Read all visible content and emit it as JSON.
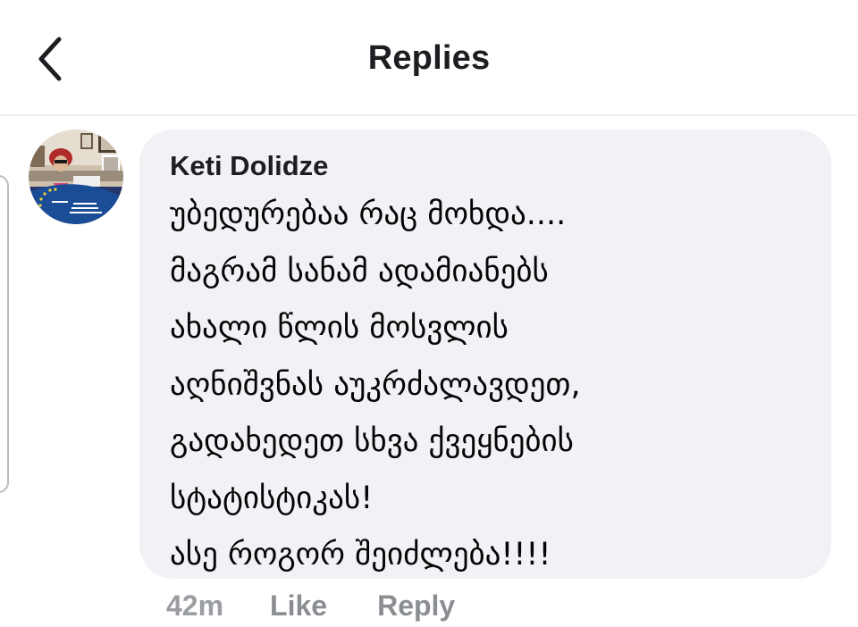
{
  "header": {
    "title": "Replies",
    "back_icon": "chevron-left-icon"
  },
  "comment": {
    "author": "Keti Dolidze",
    "lines": [
      "უბედურებაა რაც მოხდა....",
      "მაგრამ სანამ ადამიანებს",
      "ახალი წლის მოსვლის",
      "აღნიშვნას აუკრძალავდეთ,",
      "გადახედეთ სხვა ქვეყნების",
      "სტატისტიკას!",
      "ასე როგორ შეიძლება!!!!"
    ],
    "time": "42m",
    "like_label": "Like",
    "reply_label": "Reply"
  },
  "colors": {
    "bubble_bg": "#f0f2f5",
    "text": "#050505",
    "muted": "#8a8d91",
    "divider": "#f0f1f3"
  }
}
